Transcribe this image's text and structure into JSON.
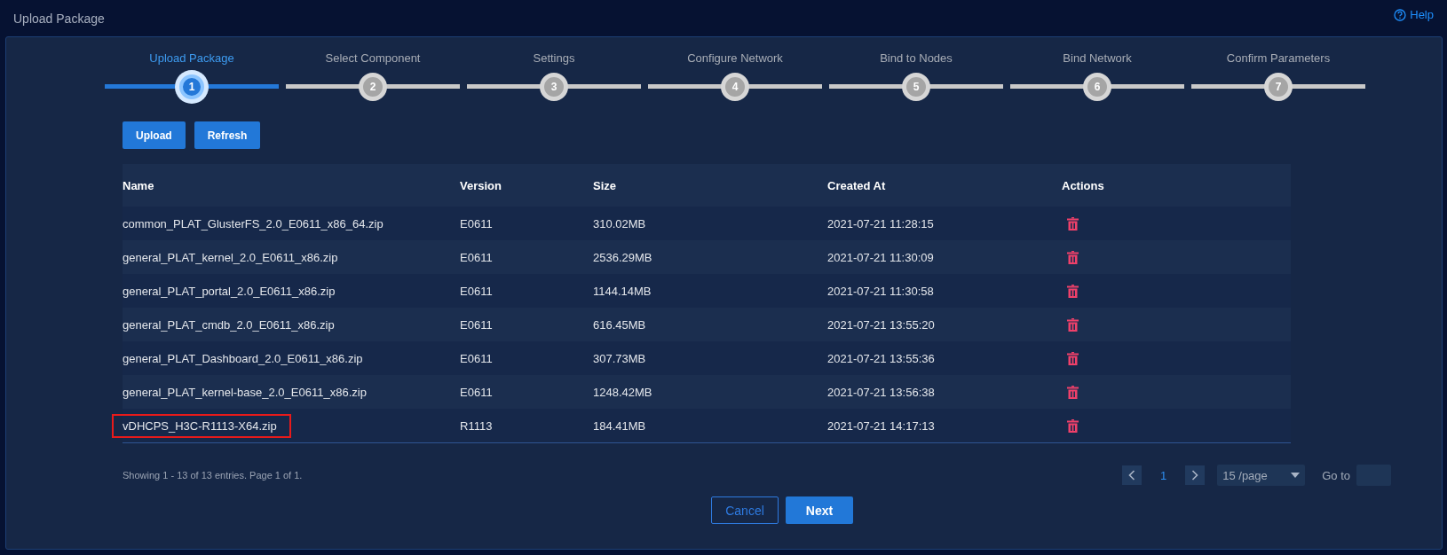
{
  "page_title": "Upload Package",
  "help_link": "Help",
  "steps": [
    {
      "number": "1",
      "label": "Upload Package",
      "selected": true
    },
    {
      "number": "2",
      "label": "Select Component",
      "selected": false
    },
    {
      "number": "3",
      "label": "Settings",
      "selected": false
    },
    {
      "number": "4",
      "label": "Configure Network",
      "selected": false
    },
    {
      "number": "5",
      "label": "Bind to Nodes",
      "selected": false
    },
    {
      "number": "6",
      "label": "Bind Network",
      "selected": false
    },
    {
      "number": "7",
      "label": "Confirm Parameters",
      "selected": false
    }
  ],
  "toolbar": [
    "Upload",
    "Refresh"
  ],
  "table": {
    "columns": [
      "Name",
      "Version",
      "Size",
      "Created At",
      "Actions"
    ],
    "rows": [
      {
        "name": "common_PLAT_GlusterFS_2.0_E0611_x86_64.zip",
        "version": "E0611",
        "size": "310.02MB",
        "created_at": "2021-07-21 11:28:15",
        "highlighted": false
      },
      {
        "name": "general_PLAT_kernel_2.0_E0611_x86.zip",
        "version": "E0611",
        "size": "2536.29MB",
        "created_at": "2021-07-21 11:30:09",
        "highlighted": false
      },
      {
        "name": "general_PLAT_portal_2.0_E0611_x86.zip",
        "version": "E0611",
        "size": "1144.14MB",
        "created_at": "2021-07-21 11:30:58",
        "highlighted": false
      },
      {
        "name": "general_PLAT_cmdb_2.0_E0611_x86.zip",
        "version": "E0611",
        "size": "616.45MB",
        "created_at": "2021-07-21 13:55:20",
        "highlighted": false
      },
      {
        "name": "general_PLAT_Dashboard_2.0_E0611_x86.zip",
        "version": "E0611",
        "size": "307.73MB",
        "created_at": "2021-07-21 13:55:36",
        "highlighted": false
      },
      {
        "name": "general_PLAT_kernel-base_2.0_E0611_x86.zip",
        "version": "E0611",
        "size": "1248.42MB",
        "created_at": "2021-07-21 13:56:38",
        "highlighted": false
      },
      {
        "name": "vDHCPS_H3C-R1113-X64.zip",
        "version": "R1113",
        "size": "184.41MB",
        "created_at": "2021-07-21 14:17:13",
        "highlighted": true
      }
    ]
  },
  "footer": {
    "summary": "Showing 1 - 13 of 13 entries. Page 1 of 1.",
    "page": "1",
    "page_size": "15 /page",
    "goto_label": "Go to"
  },
  "buttons": [
    "Cancel",
    "Next"
  ]
}
